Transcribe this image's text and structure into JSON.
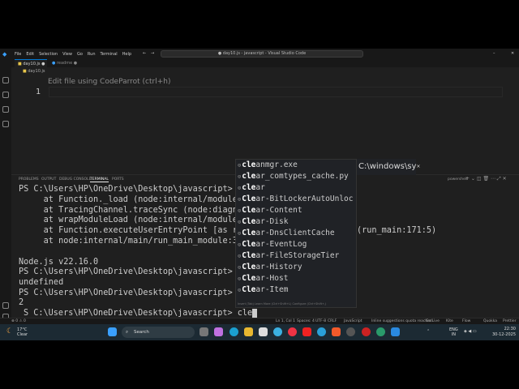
{
  "window": {
    "title": "● day10.js - javascript - Visual Studio Code",
    "menu": [
      "File",
      "Edit",
      "Selection",
      "View",
      "Go",
      "Run",
      "Terminal",
      "Help"
    ]
  },
  "tabs": [
    {
      "label": "day10.js"
    },
    {
      "label": "readme"
    }
  ],
  "breadcrumb": "day10.js",
  "editor": {
    "hint": "Edit file using CodeParrot (ctrl+h)",
    "line_number": "1"
  },
  "panel": {
    "tabs": [
      "PROBLEMS",
      "OUTPUT",
      "DEBUG CONSOLE",
      "TERMINAL",
      "PORTS"
    ],
    "active": "TERMINAL",
    "shell": "powershell"
  },
  "terminal": {
    "lines": [
      "PS C:\\Users\\HP\\OneDrive\\Desktop\\javascript> nod",
      "     at Function._load (node:internal/modules/cj",
      "     at TracingChannel.traceSync (node:diagnosti",
      "     at wrapModuleLoad (node:internal/modules/cj",
      "     at Function.executeUserEntryPoint [as runMa",
      "     at node:internal/main/run_main_module:36:49",
      "",
      "Node.js v22.16.0",
      "PS C:\\Users\\HP\\OneDrive\\Desktop\\javascript> nod",
      "undefined",
      "PS C:\\Users\\HP\\OneDrive\\Desktop\\javascript> nod",
      "2",
      "S C:\\Users\\HP\\OneDrive\\Desktop\\javascript> cle"
    ],
    "trailing": "(run_main:171:5)"
  },
  "suggestions": {
    "items": [
      {
        "match": "cle",
        "rest": "anmgr.exe"
      },
      {
        "match": "cle",
        "rest": "ar_comtypes_cache.py"
      },
      {
        "match": "cle",
        "rest": "ar"
      },
      {
        "match": "Cle",
        "rest": "ar-BitLockerAutoUnloc"
      },
      {
        "match": "Cle",
        "rest": "ar-Content"
      },
      {
        "match": "Cle",
        "rest": "ar-Disk"
      },
      {
        "match": "Cle",
        "rest": "ar-DnsClientCache"
      },
      {
        "match": "Cle",
        "rest": "ar-EventLog"
      },
      {
        "match": "Cle",
        "rest": "ar-FileStorageTier"
      },
      {
        "match": "Cle",
        "rest": "ar-History"
      },
      {
        "match": "Cle",
        "rest": "ar-Host"
      },
      {
        "match": "Cle",
        "rest": "ar-Item"
      }
    ],
    "footer": "Insert (Tab)       Learn More (Ctrl+Shift+L)  Configure (Ctrl+Shift+,)",
    "detail": "C:\\windows\\sy"
  },
  "status": {
    "problems": "⊗ 0 ⚠ 0",
    "position": "Ln 1, Col 1",
    "spaces": "Spaces: 4",
    "encoding": "UTF-8",
    "eol": "CRLF",
    "language": "JavaScript",
    "inline": "Inline suggestions quota reached",
    "golive": "Go Live",
    "extra": [
      "Kite",
      "Flow",
      "Quokka",
      "Prettier"
    ]
  },
  "taskbar": {
    "weather_temp": "17°C",
    "weather_desc": "Clear",
    "search": "Search",
    "lang": "ENG",
    "region": "IN",
    "time": "22:30",
    "date": "30-12-2025"
  },
  "colors": {
    "editor_bg": "#1f1f1f",
    "taskbar_bg": "#1c2a33",
    "accent": "#0078d4"
  }
}
